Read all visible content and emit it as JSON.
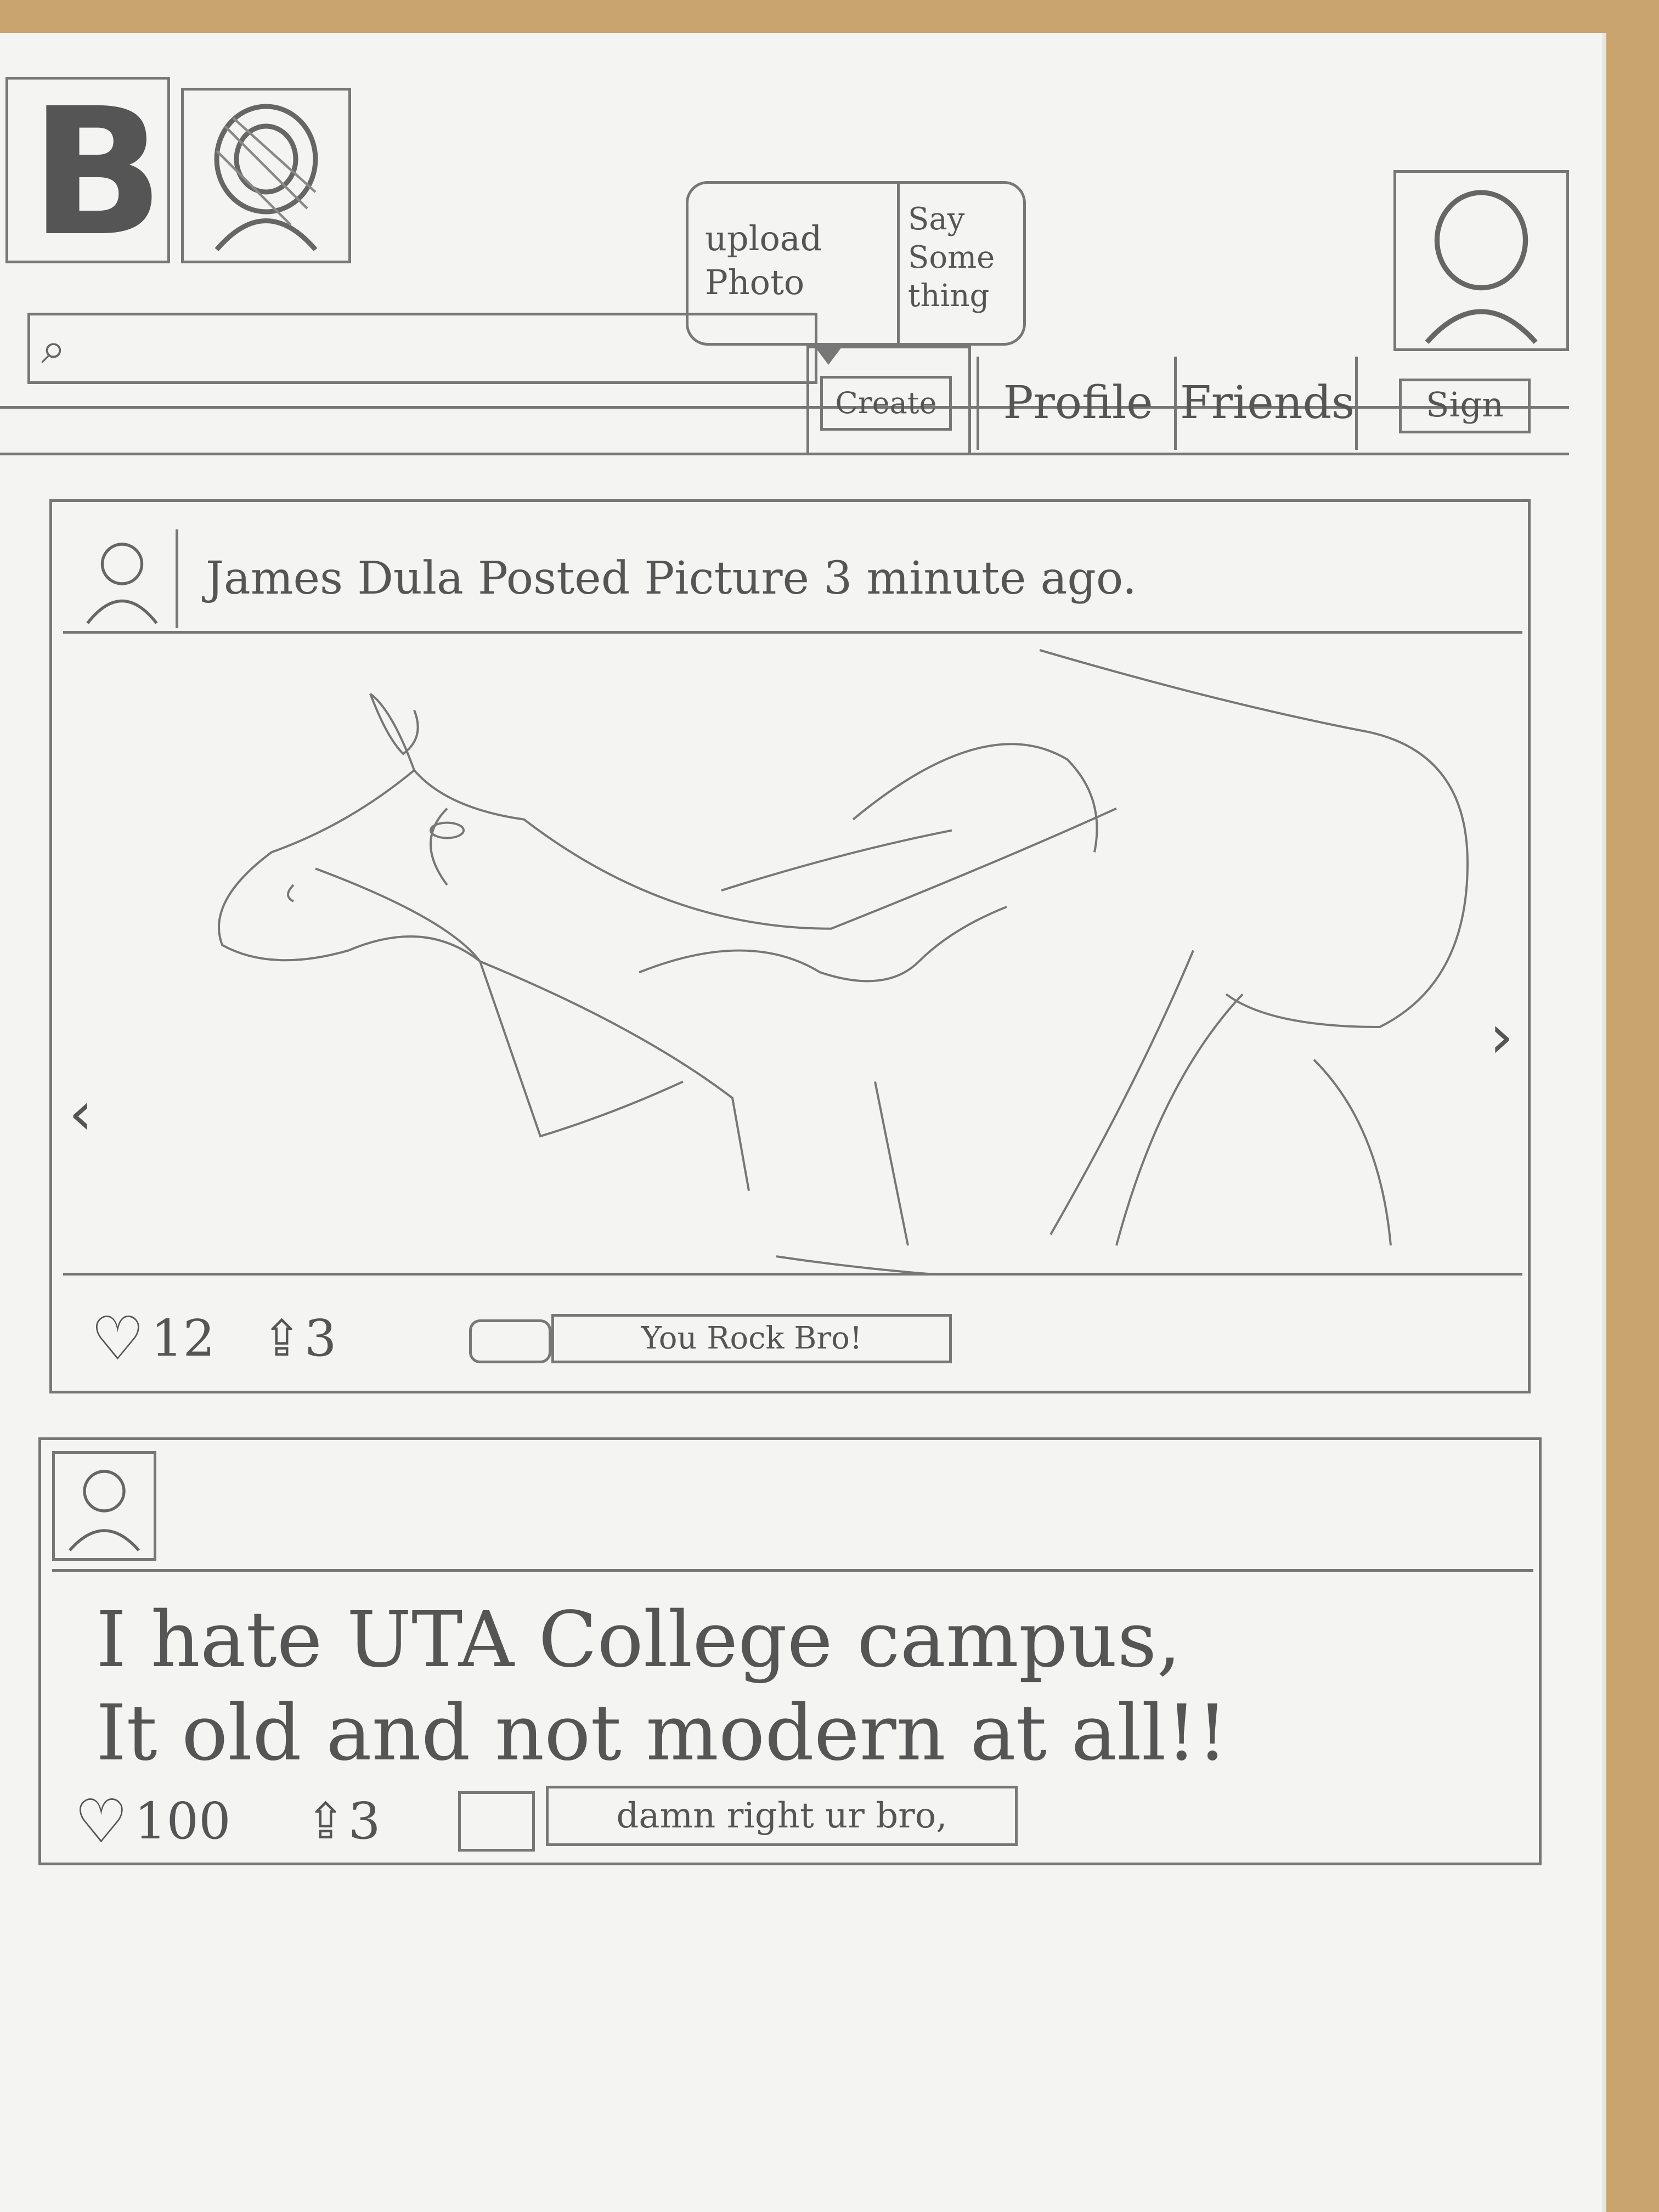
{
  "header": {
    "logo_letter": "B",
    "create_popup": {
      "option_upload": "upload Photo",
      "option_say": "Say Some thing"
    },
    "search": {
      "icon": "search-icon"
    },
    "create_label": "Create",
    "nav": {
      "profile": "Profile",
      "friends": "Friends",
      "sign": "Sign"
    }
  },
  "posts": [
    {
      "meta": "James Dula Posted Picture 3 minute ago.",
      "image": "horse-sketch",
      "likes": "12",
      "shares": "3",
      "comment": "You Rock Bro!"
    },
    {
      "text_line1": "I hate UTA College campus,",
      "text_line2": "It old and not modern at all!!",
      "likes": "100",
      "shares": "3",
      "comment": "damn right ur bro,"
    }
  ],
  "colors": {
    "paper": "#f4f4f2",
    "pencil": "#777777",
    "table": "#c9a46f"
  }
}
